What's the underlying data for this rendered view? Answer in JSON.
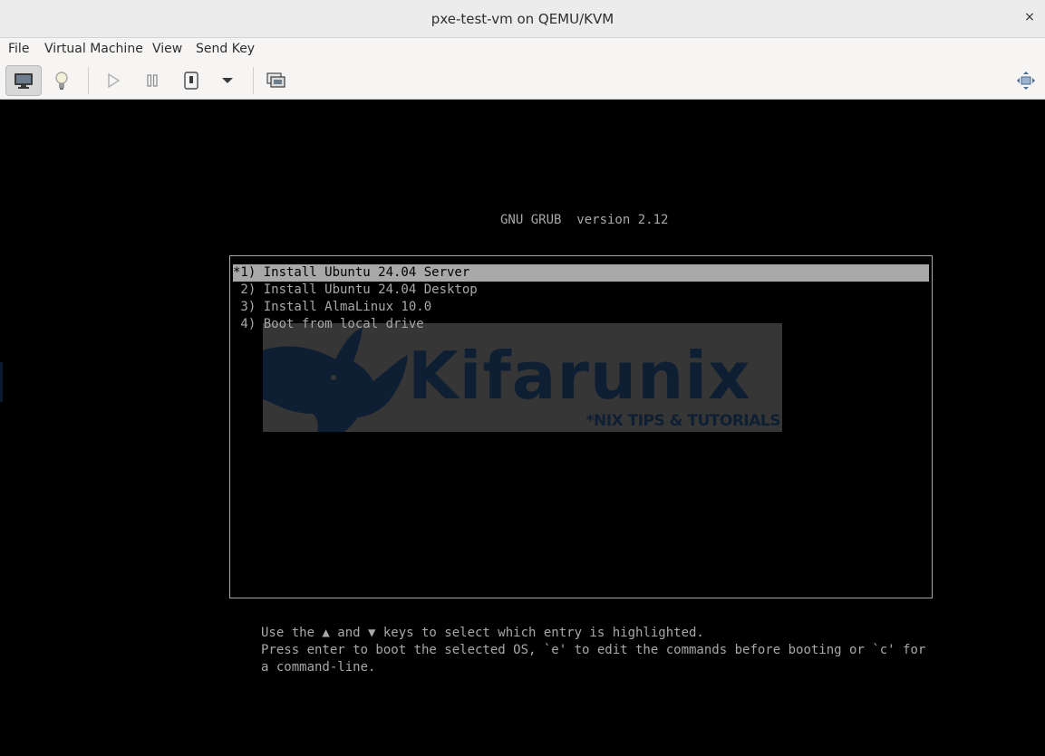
{
  "window": {
    "title": "pxe-test-vm on QEMU/KVM",
    "close_glyph": "×"
  },
  "menubar": {
    "items": [
      "File",
      "Virtual Machine",
      "View",
      "Send Key"
    ]
  },
  "toolbar": {
    "buttons": [
      {
        "icon": "monitor-icon",
        "active": true
      },
      {
        "icon": "lightbulb-icon",
        "active": false
      },
      {
        "icon": "play-icon",
        "active": false
      },
      {
        "icon": "pause-icon",
        "active": false
      },
      {
        "icon": "power-icon",
        "active": false
      },
      {
        "icon": "dropdown-arrow-icon",
        "active": false
      },
      {
        "icon": "snapshots-icon",
        "active": false
      },
      {
        "icon": "resize-icon",
        "active": false
      }
    ]
  },
  "grub": {
    "title": "GNU GRUB  version 2.12",
    "entries": [
      {
        "label": "*1) Install Ubuntu 24.04 Server",
        "selected": true
      },
      {
        "label": " 2) Install Ubuntu 24.04 Desktop",
        "selected": false
      },
      {
        "label": " 3) Install AlmaLinux 10.0",
        "selected": false
      },
      {
        "label": " 4) Boot from local drive",
        "selected": false
      }
    ],
    "background_logo": {
      "name": "Kifarunix",
      "tagline": "*NIX TIPS & TUTORIALS"
    },
    "help": {
      "line1": "Use the ▲ and ▼ keys to select which entry is highlighted.",
      "line2": "Press enter to boot the selected OS, `e' to edit the commands before booting or `c' for",
      "line3": "a command-line."
    }
  },
  "colors": {
    "grub_fg": "#a8a8a8",
    "grub_bg": "#000000",
    "logo_bg": "#363636",
    "logo_text": "#0f1f33"
  }
}
